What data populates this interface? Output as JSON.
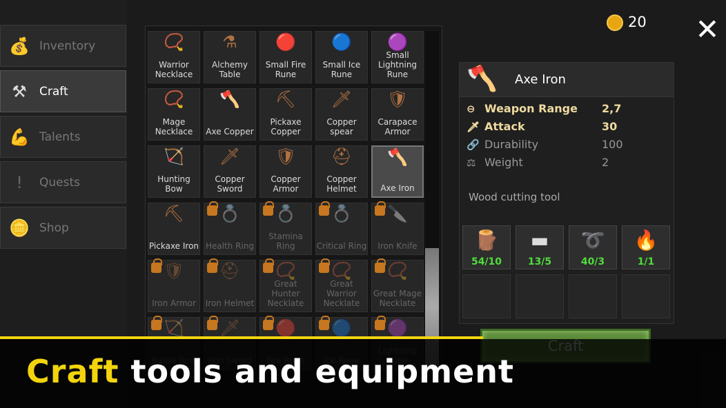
{
  "sidebar": {
    "tabs": [
      {
        "label": "Inventory",
        "icon": "bag-icon",
        "active": false
      },
      {
        "label": "Craft",
        "icon": "anvil-icon",
        "active": true
      },
      {
        "label": "Talents",
        "icon": "strength-icon",
        "active": false
      },
      {
        "label": "Quests",
        "icon": "exclamation-icon",
        "active": false
      },
      {
        "label": "Shop",
        "icon": "coins-icon",
        "active": false
      }
    ]
  },
  "grid": {
    "items": [
      {
        "name": "Warrior Necklace",
        "locked": false
      },
      {
        "name": "Alchemy Table",
        "locked": false
      },
      {
        "name": "Small Fire Rune",
        "locked": false
      },
      {
        "name": "Small Ice Rune",
        "locked": false
      },
      {
        "name": "Small Lightning Rune",
        "locked": false
      },
      {
        "name": "Mage Necklace",
        "locked": false
      },
      {
        "name": "Axe Copper",
        "locked": false
      },
      {
        "name": "Pickaxe Copper",
        "locked": false
      },
      {
        "name": "Copper spear",
        "locked": false
      },
      {
        "name": "Carapace Armor",
        "locked": false
      },
      {
        "name": "Hunting Bow",
        "locked": false
      },
      {
        "name": "Copper Sword",
        "locked": false
      },
      {
        "name": "Copper Armor",
        "locked": false
      },
      {
        "name": "Copper Helmet",
        "locked": false
      },
      {
        "name": "Axe Iron",
        "locked": false,
        "selected": true
      },
      {
        "name": "Pickaxe Iron",
        "locked": false
      },
      {
        "name": "Health Ring",
        "locked": true
      },
      {
        "name": "Stamina Ring",
        "locked": true
      },
      {
        "name": "Critical Ring",
        "locked": true
      },
      {
        "name": "Iron Knife",
        "locked": true
      },
      {
        "name": "Iron Armor",
        "locked": true
      },
      {
        "name": "Iron Helmet",
        "locked": true
      },
      {
        "name": "Great Hunter Necklate",
        "locked": true
      },
      {
        "name": "Great Warrior Necklate",
        "locked": true
      },
      {
        "name": "Great Mage Necklate",
        "locked": true
      },
      {
        "name": "Battle Bow",
        "locked": true
      },
      {
        "name": "Iron Sword",
        "locked": true
      },
      {
        "name": "Fire Rune",
        "locked": true
      },
      {
        "name": "Ice Rune",
        "locked": true
      },
      {
        "name": "Lightning Rune",
        "locked": true
      }
    ]
  },
  "detail": {
    "title": "Axe Iron",
    "stats": [
      {
        "name": "Weapon Range",
        "value": "2,7",
        "icon": "range-icon",
        "highlight": true
      },
      {
        "name": "Attack",
        "value": "30",
        "icon": "sword-icon",
        "highlight": true
      },
      {
        "name": "Durability",
        "value": "100",
        "icon": "chain-icon",
        "highlight": false
      },
      {
        "name": "Weight",
        "value": "2",
        "icon": "weight-icon",
        "highlight": false
      }
    ],
    "description": "Wood cutting tool",
    "materials": [
      {
        "name": "log",
        "count": "54/10"
      },
      {
        "name": "iron-ingot",
        "count": "13/5"
      },
      {
        "name": "rope",
        "count": "40/3"
      },
      {
        "name": "torch",
        "count": "1/1"
      }
    ]
  },
  "craft_label": "Craft",
  "coins": "20",
  "banner": {
    "highlight": "Craft",
    "rest": " tools and equipment"
  },
  "colors": {
    "accent": "#f2d40e",
    "count": "#4fdc3c",
    "stat_highlight": "#eed9a0"
  }
}
